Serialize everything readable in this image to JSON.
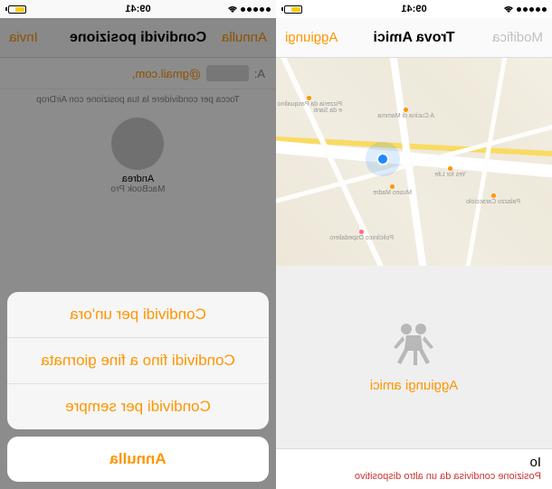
{
  "time": "09:41",
  "trova": {
    "nav": {
      "left": "Modifica",
      "title": "Trova Amici",
      "right": "Aggiungi"
    },
    "map": {
      "pois": [
        {
          "label": "Pizzeria da Pasqualino e da Santi"
        },
        {
          "label": "A Cucina di Mamma"
        },
        {
          "label": "Yes for Life"
        },
        {
          "label": "Museo Madre"
        },
        {
          "label": "Palazzo Caracciolo"
        },
        {
          "label": "Policlinico Ospedaliero"
        }
      ]
    },
    "add_label": "Aggiungi amici",
    "me": {
      "title": "Io",
      "subtitle": "Posizione condivisa da un altro dispositivo"
    }
  },
  "condividi": {
    "nav": {
      "left": "Annulla",
      "title": "Condividi posizione",
      "right": "Invia"
    },
    "to_label": "A:",
    "to_value_suffix": "@gmail.com,",
    "hint": "Tocca per condividere la tua posizione con AirDrop",
    "airdrop": {
      "name": "Andrea",
      "device": "MacBook Pro"
    },
    "sheet": {
      "options": [
        "Condividi per un'ora",
        "Condividi fino a fine giornata",
        "Condividi per sempre"
      ],
      "cancel": "Annulla"
    }
  }
}
